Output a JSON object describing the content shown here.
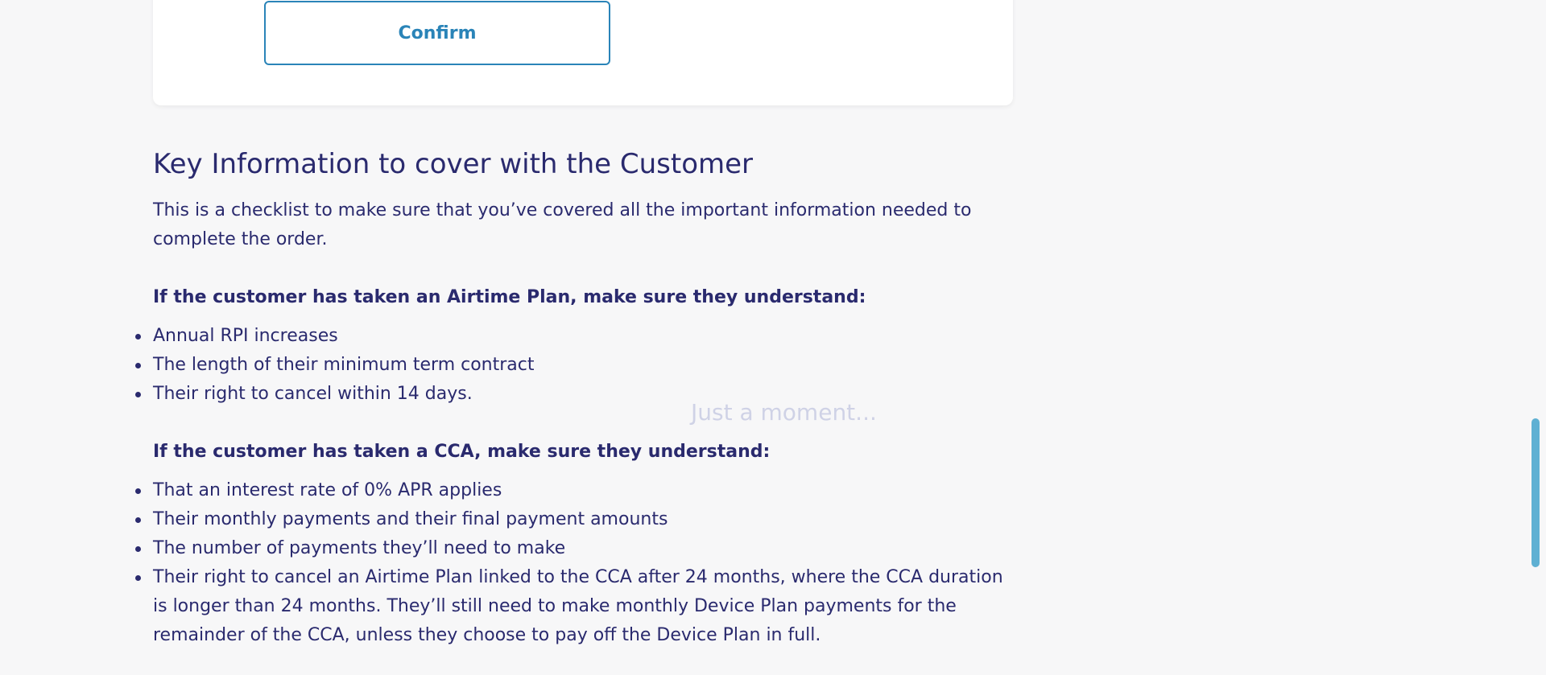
{
  "card": {
    "confirm_label": "Confirm"
  },
  "key_info": {
    "heading": "Key Information to cover with the Customer",
    "intro": "This is a checklist to make sure that you’ve covered all the important information needed to complete the order.",
    "airtime": {
      "title": "If the customer has taken an Airtime Plan, make sure they understand:",
      "items": [
        "Annual RPI increases",
        "The length of their minimum term contract",
        "Their right to cancel within 14 days."
      ]
    },
    "cca": {
      "title": "If the customer has taken a CCA, make sure they understand:",
      "items": [
        "That an interest rate of 0% APR applies",
        "Their monthly payments and their final payment amounts",
        "The number of payments they’ll need to make",
        "Their right to cancel an Airtime Plan linked to the CCA after 24 months, where the CCA duration is longer than 24 months. They’ll still need to make monthly Device Plan payments for the remainder of the CCA, unless they choose to pay off the Device Plan in full."
      ]
    }
  },
  "overlay": {
    "loading_text": "Just a moment..."
  },
  "colors": {
    "text": "#2a2a6e",
    "accent": "#2a84b8",
    "background": "#f7f7f8",
    "scrollbar": "#5fb0d3"
  }
}
